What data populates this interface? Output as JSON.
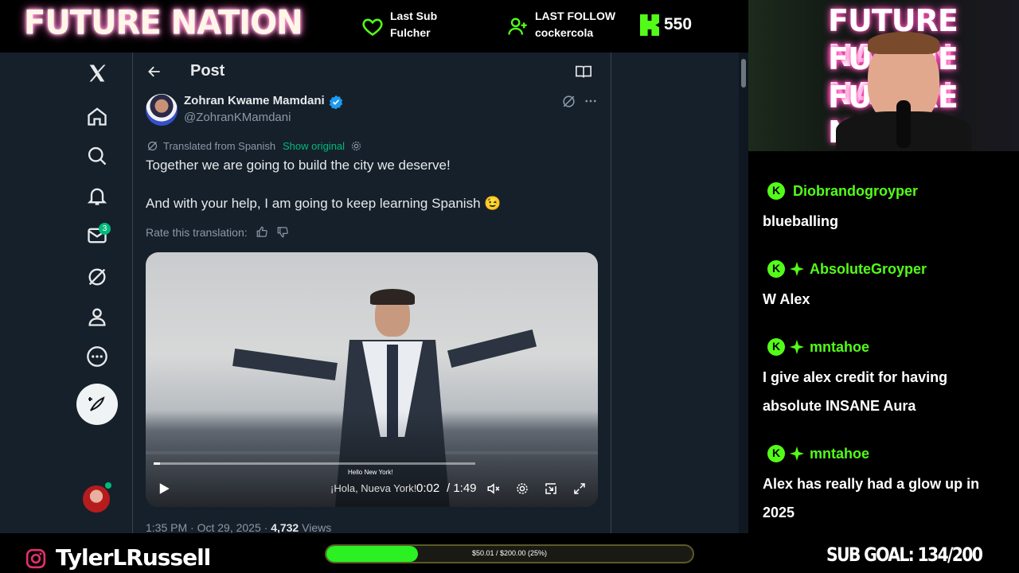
{
  "overlay": {
    "brand": "FUTURE NATION",
    "last_sub_label": "Last Sub",
    "last_sub_name": "Fulcher",
    "last_follow_label": "LAST FOLLOW",
    "last_follow_name": "cockercola",
    "kick_count": "550",
    "instagram_handle": "TylerLRussell",
    "goal_text": "$50.01 / $200.00 (25%)",
    "goal_progress": 0.25,
    "sub_goal": "SUB GOAL: 134/200",
    "webcam_sign": [
      "FUTURE NATION",
      "FUTURE NATION",
      "FUTURE NATION"
    ]
  },
  "nav": {
    "icons": [
      "x-logo-icon",
      "home-icon",
      "search-icon",
      "notifications-icon",
      "messages-icon",
      "grok-icon",
      "profile-icon",
      "more-icon",
      "post-icon",
      "account-avatar"
    ],
    "messages_badge": "3"
  },
  "post": {
    "header_title": "Post",
    "author_name": "Zohran Kwame Mamdani",
    "author_handle": "@ZohranKMamdani",
    "translated_label": "Translated from Spanish",
    "show_original": "Show original",
    "text_line1": "Together we are going to build the city we deserve!",
    "text_line2": "And with your help, I am going to keep learning Spanish",
    "emoji": "😉",
    "rate_label": "Rate this translation:",
    "video_caption_top": "Hello New York!",
    "video_caption_bottom": "¡Hola, Nueva York!",
    "video_time": "0:02",
    "video_duration": "/ 1:49",
    "timestamp": "1:35 PM · Oct 29, 2025 ·",
    "views_count": "4,732",
    "views_label": "Views",
    "colors": {
      "verified": "#1d9bf0",
      "link_green": "#00ba7c"
    }
  },
  "chat": [
    {
      "user": "Diobrandogroyper",
      "badges": [
        "kick"
      ],
      "message": "blueballing"
    },
    {
      "user": "AbsoluteGroyper",
      "badges": [
        "kick",
        "sub"
      ],
      "message": "W Alex"
    },
    {
      "user": "mntahoe",
      "badges": [
        "kick",
        "sub"
      ],
      "message": "I give alex credit for having absolute INSANE Aura"
    },
    {
      "user": "mntahoe",
      "badges": [
        "kick",
        "sub"
      ],
      "message": "Alex has really had a glow up in 2025"
    }
  ]
}
